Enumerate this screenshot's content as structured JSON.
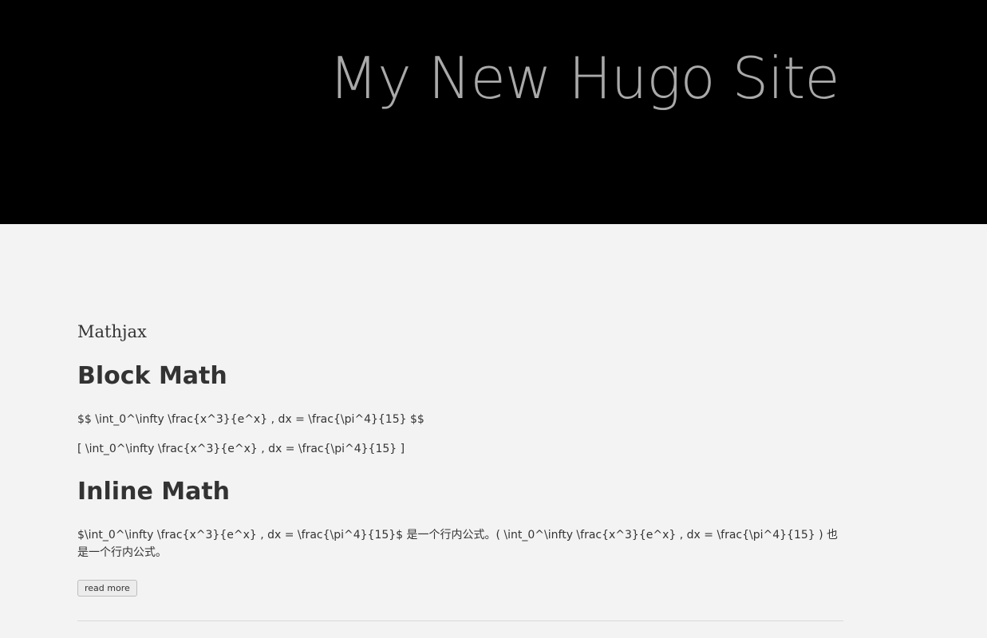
{
  "header": {
    "site_title": "My New Hugo Site"
  },
  "post": {
    "title": "Mathjax",
    "block_heading": "Block Math",
    "block_line_1": "$$ \\int_0^\\infty \\frac{x^3}{e^x} , dx = \\frac{\\pi^4}{15} $$",
    "block_line_2": "[ \\int_0^\\infty \\frac{x^3}{e^x} , dx = \\frac{\\pi^4}{15} ]",
    "inline_heading": "Inline Math",
    "inline_paragraph": "$\\int_0^\\infty \\frac{x^3}{e^x} , dx = \\frac{\\pi^4}{15}$ 是一个行内公式。( \\int_0^\\infty \\frac{x^3}{e^x} , dx = \\frac{\\pi^4}{15} ) 也是一个行内公式。",
    "read_more_label": "read more"
  },
  "colors": {
    "header_bg": "#000000",
    "header_text": "#a9a9a9",
    "page_bg": "#f3f3f3",
    "body_text": "#333333"
  }
}
